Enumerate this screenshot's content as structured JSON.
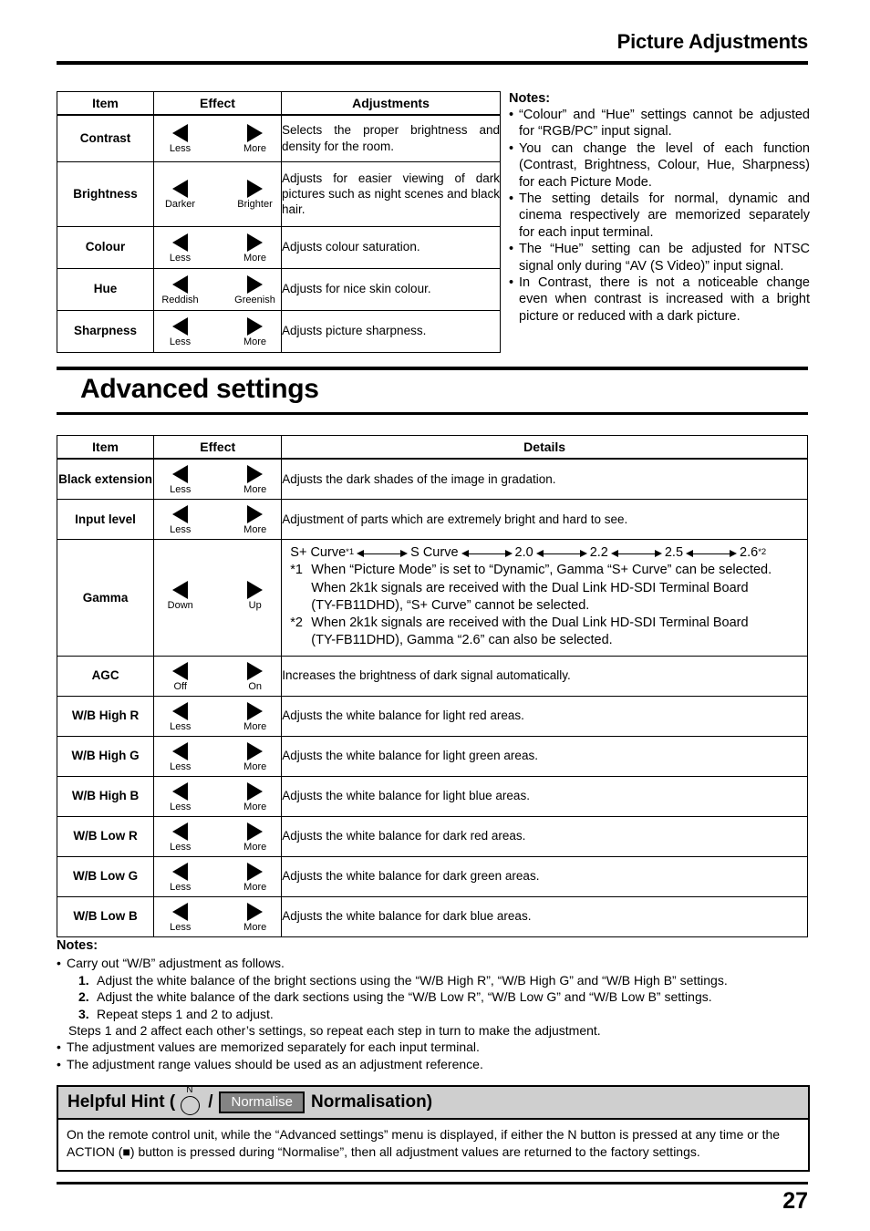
{
  "header": {
    "title": "Picture Adjustments"
  },
  "picture_table": {
    "columns": [
      "Item",
      "Effect",
      "Adjustments"
    ],
    "rows": [
      {
        "item": "Contrast",
        "left_label": "Less",
        "right_label": "More",
        "description": "Selects the proper brightness and density for the room."
      },
      {
        "item": "Brightness",
        "left_label": "Darker",
        "right_label": "Brighter",
        "description": "Adjusts for easier viewing of dark pictures such as night scenes and black hair."
      },
      {
        "item": "Colour",
        "left_label": "Less",
        "right_label": "More",
        "description": "Adjusts colour saturation."
      },
      {
        "item": "Hue",
        "left_label": "Reddish",
        "right_label": "Greenish",
        "description": "Adjusts for nice skin colour."
      },
      {
        "item": "Sharpness",
        "left_label": "Less",
        "right_label": "More",
        "description": "Adjusts picture sharpness."
      }
    ]
  },
  "notes_top": {
    "title": "Notes:",
    "items": [
      "“Colour” and “Hue” settings cannot be adjusted for “RGB/PC” input signal.",
      "You can change the level of each function (Contrast, Brightness, Colour, Hue, Sharpness) for each Picture Mode.",
      "The setting details for normal, dynamic and cinema respectively are memorized separately for each input terminal.",
      "The “Hue” setting can be adjusted for NTSC signal only during “AV (S Video)” input signal.",
      "In Contrast, there is not a noticeable change even when contrast is increased with a bright picture or reduced with a dark picture."
    ]
  },
  "section": {
    "title": "Advanced settings"
  },
  "advanced_table": {
    "columns": [
      "Item",
      "Effect",
      "Details"
    ],
    "rows": [
      {
        "item": "Black extension",
        "left_label": "Less",
        "right_label": "More",
        "description": "Adjusts the dark shades of the image in gradation."
      },
      {
        "item": "Input level",
        "left_label": "Less",
        "right_label": "More",
        "description": "Adjustment of parts which are extremely bright and hard to see."
      },
      {
        "item": "Gamma",
        "left_label": "Down",
        "right_label": "Up",
        "description": ""
      },
      {
        "item": "AGC",
        "left_label": "Off",
        "right_label": "On",
        "description": "Increases the brightness of dark signal automatically."
      },
      {
        "item": "W/B High R",
        "left_label": "Less",
        "right_label": "More",
        "description": "Adjusts the white balance for light red areas."
      },
      {
        "item": "W/B High G",
        "left_label": "Less",
        "right_label": "More",
        "description": "Adjusts the white balance for light green areas."
      },
      {
        "item": "W/B High B",
        "left_label": "Less",
        "right_label": "More",
        "description": "Adjusts the white balance for light blue areas."
      },
      {
        "item": "W/B Low R",
        "left_label": "Less",
        "right_label": "More",
        "description": "Adjusts the white balance for dark red areas."
      },
      {
        "item": "W/B Low G",
        "left_label": "Less",
        "right_label": "More",
        "description": "Adjusts the white balance for dark green areas."
      },
      {
        "item": "W/B Low B",
        "left_label": "Less",
        "right_label": "More",
        "description": "Adjusts the white balance for dark blue areas."
      }
    ]
  },
  "gamma_details": {
    "chain": [
      "S+ Curve",
      "S Curve",
      "2.0",
      "2.2",
      "2.5",
      "2.6"
    ],
    "chain_first_footnote": "*1",
    "chain_last_footnote": "*2",
    "footnote1_mark": "*1",
    "footnote1_line1": "When “Picture Mode” is set to “Dynamic”, Gamma “S+ Curve” can be selected.",
    "footnote1_line2": "When 2k1k signals are received with the Dual Link HD-SDI Terminal Board",
    "footnote1_line3": "(TY-FB11DHD), “S+ Curve” cannot be selected.",
    "footnote2_mark": "*2",
    "footnote2_line1": "When 2k1k signals are received with the Dual Link HD-SDI Terminal Board",
    "footnote2_line2": "(TY-FB11DHD), Gamma “2.6” can also be selected."
  },
  "notes_bottom": {
    "title": "Notes:",
    "intro": "Carry out “W/B” adjustment as follows.",
    "steps": [
      {
        "num": "1.",
        "text": "Adjust the white balance of the bright sections using the “W/B High R”, “W/B High G” and “W/B High B” settings."
      },
      {
        "num": "2.",
        "text": "Adjust the white balance of the dark sections using the “W/B Low R”, “W/B Low G” and “W/B Low B” settings."
      },
      {
        "num": "3.",
        "text": "Repeat steps 1 and 2 to adjust."
      }
    ],
    "steps_note": "Steps 1 and 2 affect each other’s settings, so repeat each step in turn to make the adjustment.",
    "items": [
      "The adjustment values are memorized separately for each input terminal.",
      "The adjustment range values should be used as an adjustment reference."
    ]
  },
  "helpful_hint": {
    "prefix": "Helpful Hint (",
    "n_label": "N",
    "separator": "/",
    "normalise_button": "Normalise",
    "suffix": "Normalisation)",
    "body": "On the remote control unit, while the “Advanced settings” menu is displayed, if either the N button is pressed at any time or the ACTION (■) button is pressed during “Normalise”, then all adjustment values are returned to the factory settings."
  },
  "footer": {
    "page_number": "27"
  }
}
